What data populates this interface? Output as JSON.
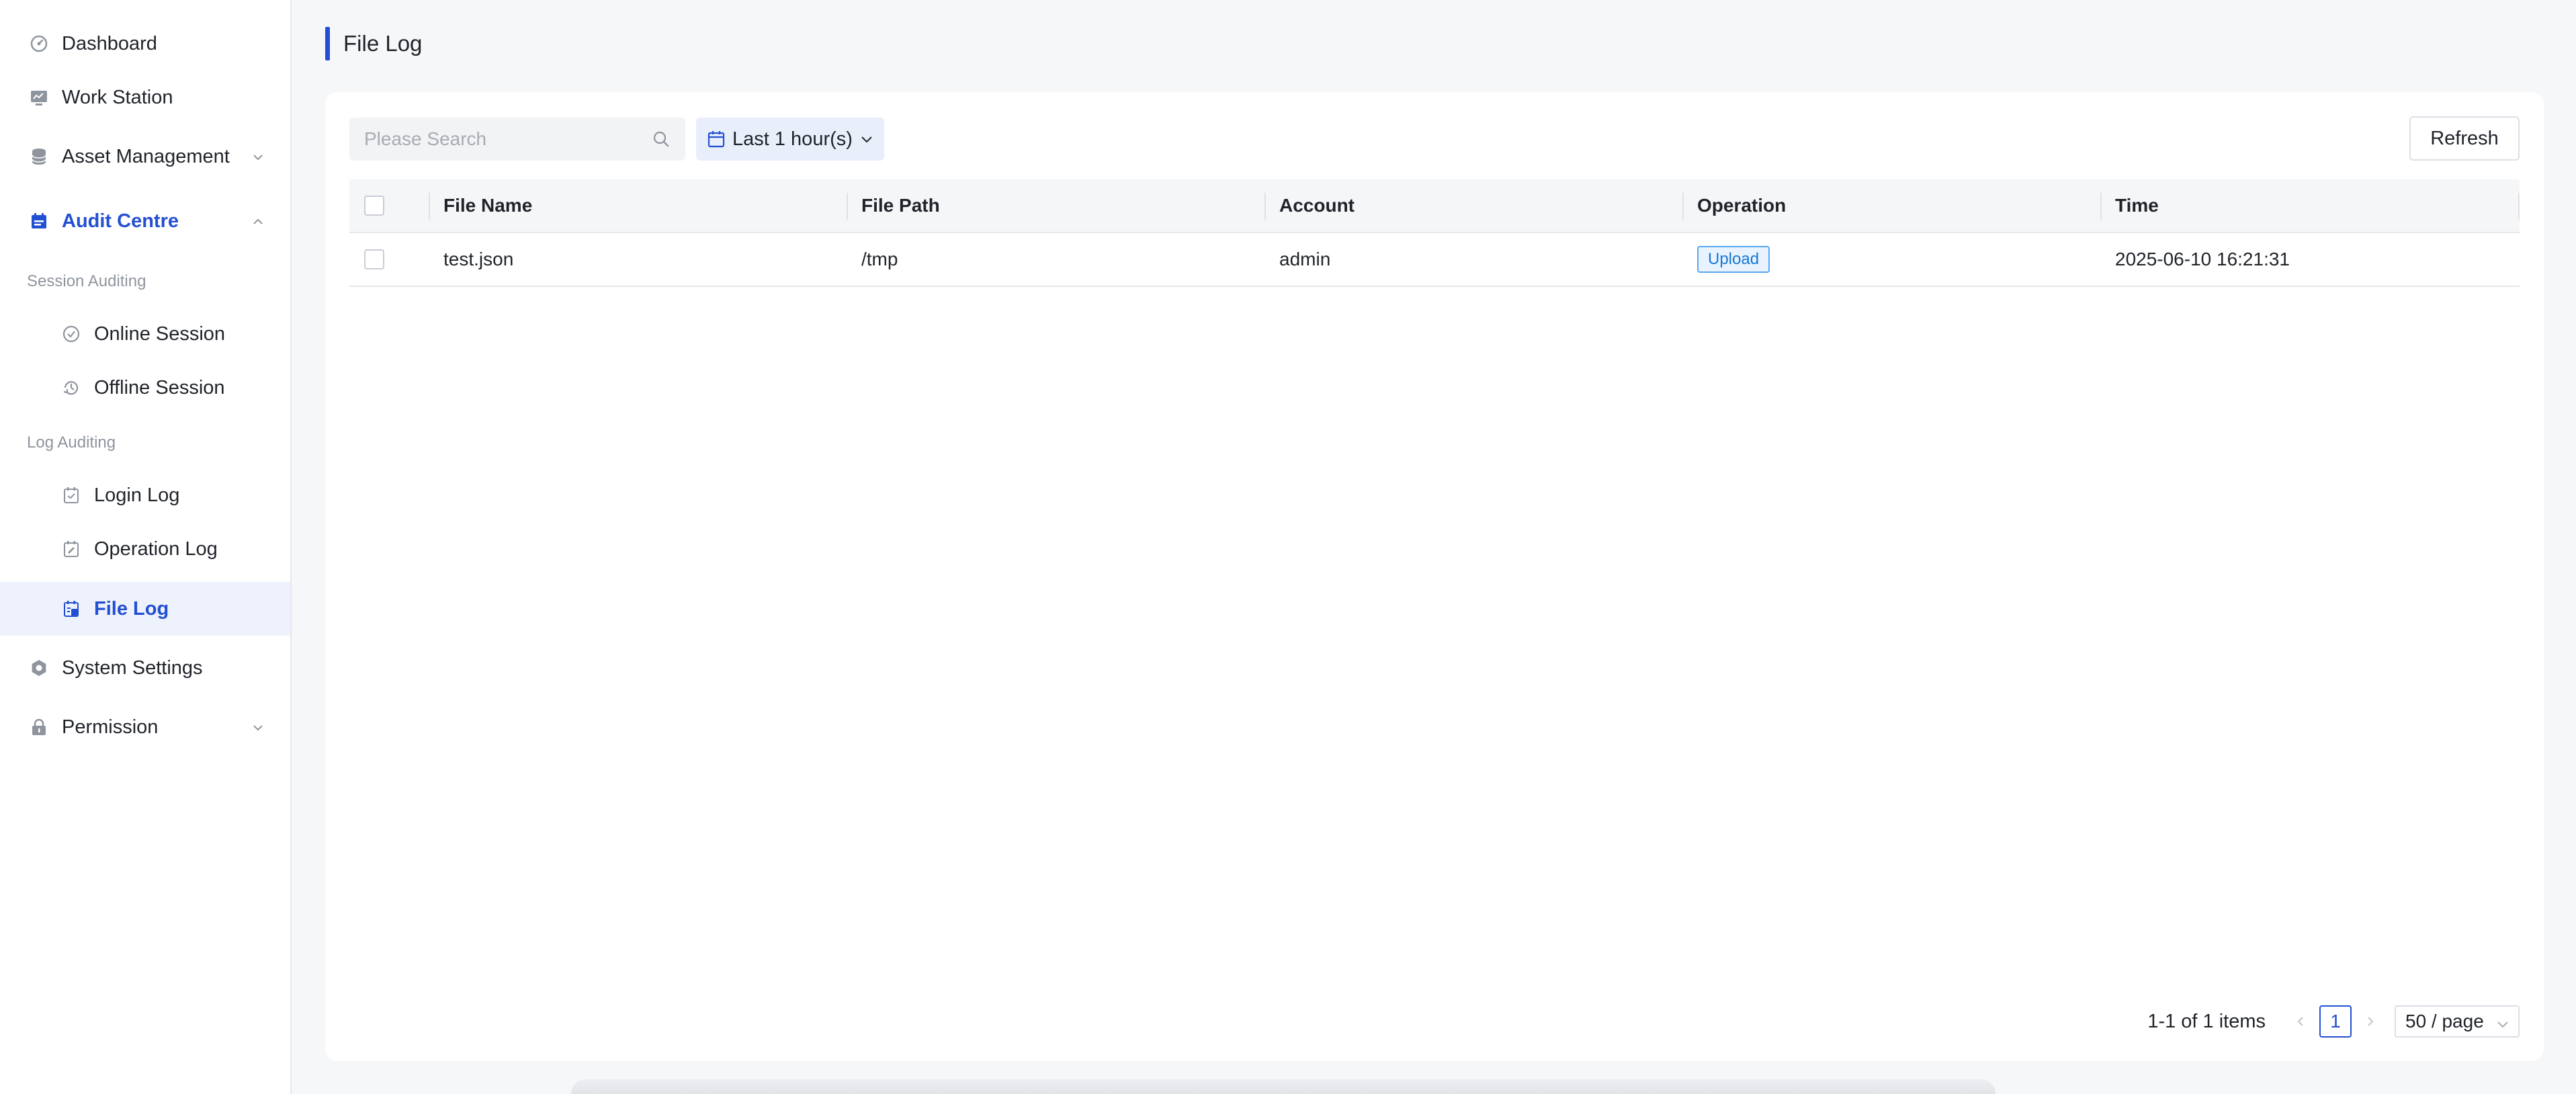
{
  "sidebar": {
    "items": [
      {
        "label": "Dashboard",
        "icon": "dashboard-icon"
      },
      {
        "label": "Work Station",
        "icon": "workstation-icon"
      },
      {
        "label": "Asset Management",
        "icon": "database-icon"
      },
      {
        "label": "Audit Centre",
        "icon": "audit-icon"
      },
      {
        "label": "System Settings",
        "icon": "gear-icon"
      },
      {
        "label": "Permission",
        "icon": "lock-icon"
      }
    ],
    "sections": {
      "session_auditing": "Session Auditing",
      "log_auditing": "Log Auditing"
    },
    "sub_items": {
      "online_session": "Online Session",
      "offline_session": "Offline Session",
      "login_log": "Login Log",
      "operation_log": "Operation Log",
      "file_log": "File Log"
    },
    "active_item": "File Log"
  },
  "header": {
    "title": "File Log"
  },
  "toolbar": {
    "search_placeholder": "Please Search",
    "time_range": "Last 1 hour(s)",
    "refresh_label": "Refresh"
  },
  "table": {
    "columns": [
      "File Name",
      "File Path",
      "Account",
      "Operation",
      "Time"
    ],
    "rows": [
      {
        "file_name": "test.json",
        "file_path": "/tmp",
        "account": "admin",
        "operation": "Upload",
        "time": "2025-06-10 16:21:31"
      }
    ]
  },
  "pagination": {
    "total_text": "1-1 of 1 items",
    "current_page": "1",
    "page_size": "50 / page"
  },
  "colors": {
    "accent": "#2350d2",
    "tag_blue": "#1677d6",
    "background": "#f6f7f9"
  }
}
